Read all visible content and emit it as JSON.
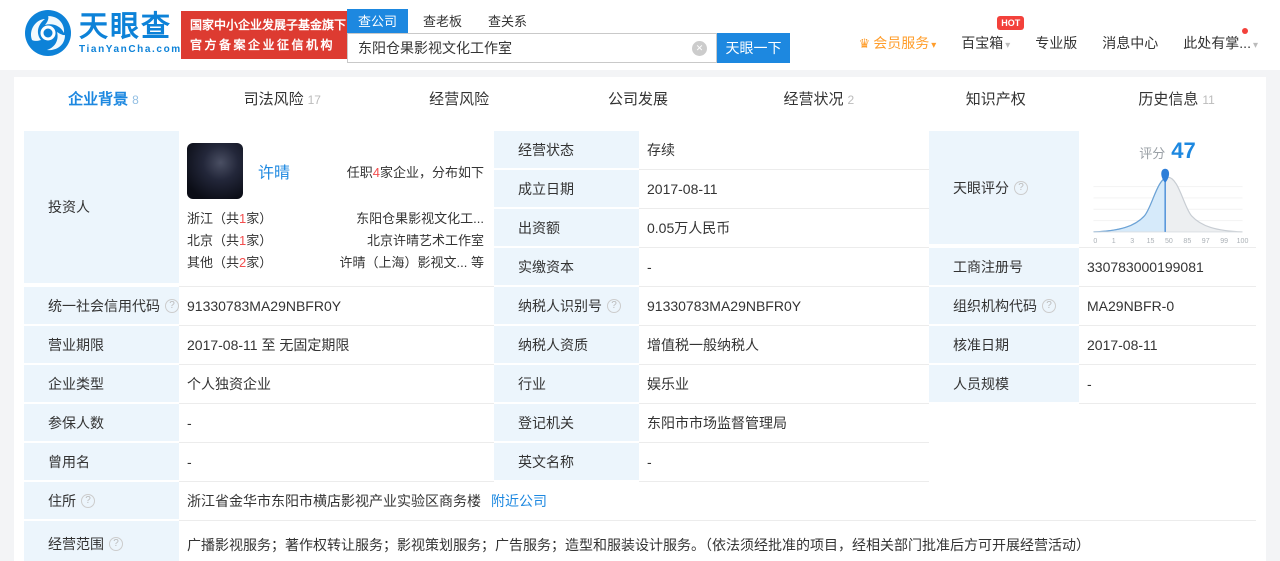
{
  "header": {
    "logo": {
      "title": "天眼查",
      "domain": "TianYanCha.com"
    },
    "badge": {
      "line1": "国家中小企业发展子基金旗下",
      "line2": "官方备案企业征信机构"
    },
    "search": {
      "tab_company": "查公司",
      "tab_boss": "查老板",
      "tab_relation": "查关系",
      "value": "东阳仓果影视文化工作室",
      "button": "天眼一下"
    },
    "nav": {
      "vip": "会员服务",
      "toolbox": "百宝箱",
      "hot": "HOT",
      "pro": "专业版",
      "messages": "消息中心",
      "more": "此处有掌..."
    }
  },
  "tabs": [
    {
      "label": "企业背景",
      "count": "8"
    },
    {
      "label": "司法风险",
      "count": "17"
    },
    {
      "label": "经营风险",
      "count": ""
    },
    {
      "label": "公司发展",
      "count": ""
    },
    {
      "label": "经营状况",
      "count": "2"
    },
    {
      "label": "知识产权",
      "count": ""
    },
    {
      "label": "历史信息",
      "count": "11"
    }
  ],
  "investor": {
    "label": "投资人",
    "name": "许晴",
    "summary": {
      "pre": "任职",
      "num": "4",
      "post": "家企业，分布如下"
    },
    "rows": [
      {
        "pre": "浙江（共",
        "num": "1",
        "post": "家）",
        "company": "东阳仓果影视文化工...",
        "extra": ""
      },
      {
        "pre": "北京（共",
        "num": "1",
        "post": "家）",
        "company": "北京许晴艺术工作室",
        "extra": ""
      },
      {
        "pre": "其他（共",
        "num": "2",
        "post": "家）",
        "company": "许晴（上海）影视文...",
        "extra": "等"
      }
    ]
  },
  "fields": {
    "jyzt": {
      "label": "经营状态",
      "value": "存续"
    },
    "clrq": {
      "label": "成立日期",
      "value": "2017-08-11"
    },
    "cze": {
      "label": "出资额",
      "value": "0.05万人民币"
    },
    "sjzb": {
      "label": "实缴资本",
      "value": "-"
    },
    "typf": {
      "label": "天眼评分"
    },
    "gszch": {
      "label": "工商注册号",
      "value": "330783000199081"
    },
    "shxydm": {
      "label": "统一社会信用代码",
      "value": "91330783MA29NBFR0Y"
    },
    "nsrsbh": {
      "label": "纳税人识别号",
      "value": "91330783MA29NBFR0Y"
    },
    "zzjgdm": {
      "label": "组织机构代码",
      "value": "MA29NBFR-0"
    },
    "yyqx": {
      "label": "营业期限",
      "value": "2017-08-11 至 无固定期限"
    },
    "nsrzz": {
      "label": "纳税人资质",
      "value": "增值税一般纳税人"
    },
    "hzrq": {
      "label": "核准日期",
      "value": "2017-08-11"
    },
    "qylx": {
      "label": "企业类型",
      "value": "个人独资企业"
    },
    "hy": {
      "label": "行业",
      "value": "娱乐业"
    },
    "rygm": {
      "label": "人员规模",
      "value": "-"
    },
    "cbrs": {
      "label": "参保人数",
      "value": "-"
    },
    "djjg": {
      "label": "登记机关",
      "value": "东阳市市场监督管理局"
    },
    "cym": {
      "label": "曾用名",
      "value": "-"
    },
    "ywmc": {
      "label": "英文名称",
      "value": "-"
    },
    "zs": {
      "label": "住所",
      "value": "浙江省金华市东阳市横店影视产业实验区商务楼",
      "link": "附近公司"
    },
    "jyfw": {
      "label": "经营范围",
      "value": "广播影视服务；著作权转让服务；影视策划服务；广告服务；造型和服装设计服务。（依法须经批准的项目，经相关部门批准后方可开展经营活动）"
    }
  },
  "score_chart": {
    "type": "area",
    "title_label": "评分",
    "score": "47",
    "marker_value": 47,
    "curve": "normal-distribution-percentile",
    "x_ticks": [
      "0",
      "1",
      "3",
      "15",
      "50",
      "85",
      "97",
      "99",
      "100"
    ],
    "accent_color": "#1d88e0"
  },
  "icons": {
    "help": "?",
    "clear": "✕",
    "caret": "▾",
    "crown": "♛"
  }
}
